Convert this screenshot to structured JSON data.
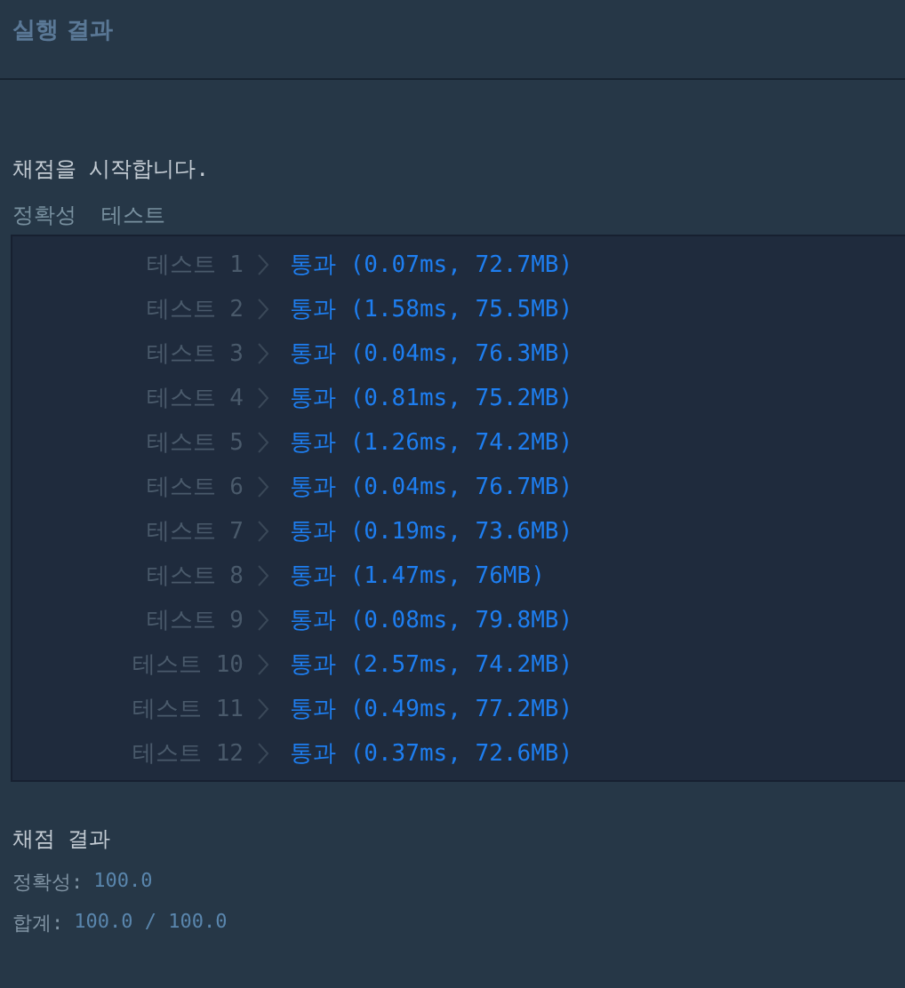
{
  "panel": {
    "title": "실행 결과"
  },
  "console": {
    "start_message": "채점을 시작합니다.",
    "section_labels": [
      "정확성",
      "테스트"
    ],
    "tests": [
      {
        "label": "테스트 1",
        "kind": "pass",
        "result": "통과 (0.07ms, 72.7MB)"
      },
      {
        "label": "테스트 2",
        "kind": "pass",
        "result": "통과 (1.58ms, 75.5MB)"
      },
      {
        "label": "테스트 3",
        "kind": "pass",
        "result": "통과 (0.04ms, 76.3MB)"
      },
      {
        "label": "테스트 4",
        "kind": "pass",
        "result": "통과 (0.81ms, 75.2MB)"
      },
      {
        "label": "테스트 5",
        "kind": "pass",
        "result": "통과 (1.26ms, 74.2MB)"
      },
      {
        "label": "테스트 6",
        "kind": "pass",
        "result": "통과 (0.04ms, 76.7MB)"
      },
      {
        "label": "테스트 7",
        "kind": "pass",
        "result": "통과 (0.19ms, 73.6MB)"
      },
      {
        "label": "테스트 8",
        "kind": "pass",
        "result": "통과 (1.47ms, 76MB)"
      },
      {
        "label": "테스트 9",
        "kind": "pass",
        "result": "통과 (0.08ms, 79.8MB)"
      },
      {
        "label": "테스트 10",
        "kind": "pass",
        "result": "통과 (2.57ms, 74.2MB)"
      },
      {
        "label": "테스트 11",
        "kind": "pass",
        "result": "통과 (0.49ms, 77.2MB)"
      },
      {
        "label": "테스트 12",
        "kind": "pass",
        "result": "통과 (0.37ms, 72.6MB)"
      }
    ]
  },
  "summary": {
    "title": "채점 결과",
    "lines": [
      {
        "label": "정확성:",
        "value": "100.0"
      },
      {
        "label": "합계:",
        "value": "100.0 / 100.0"
      }
    ]
  }
}
